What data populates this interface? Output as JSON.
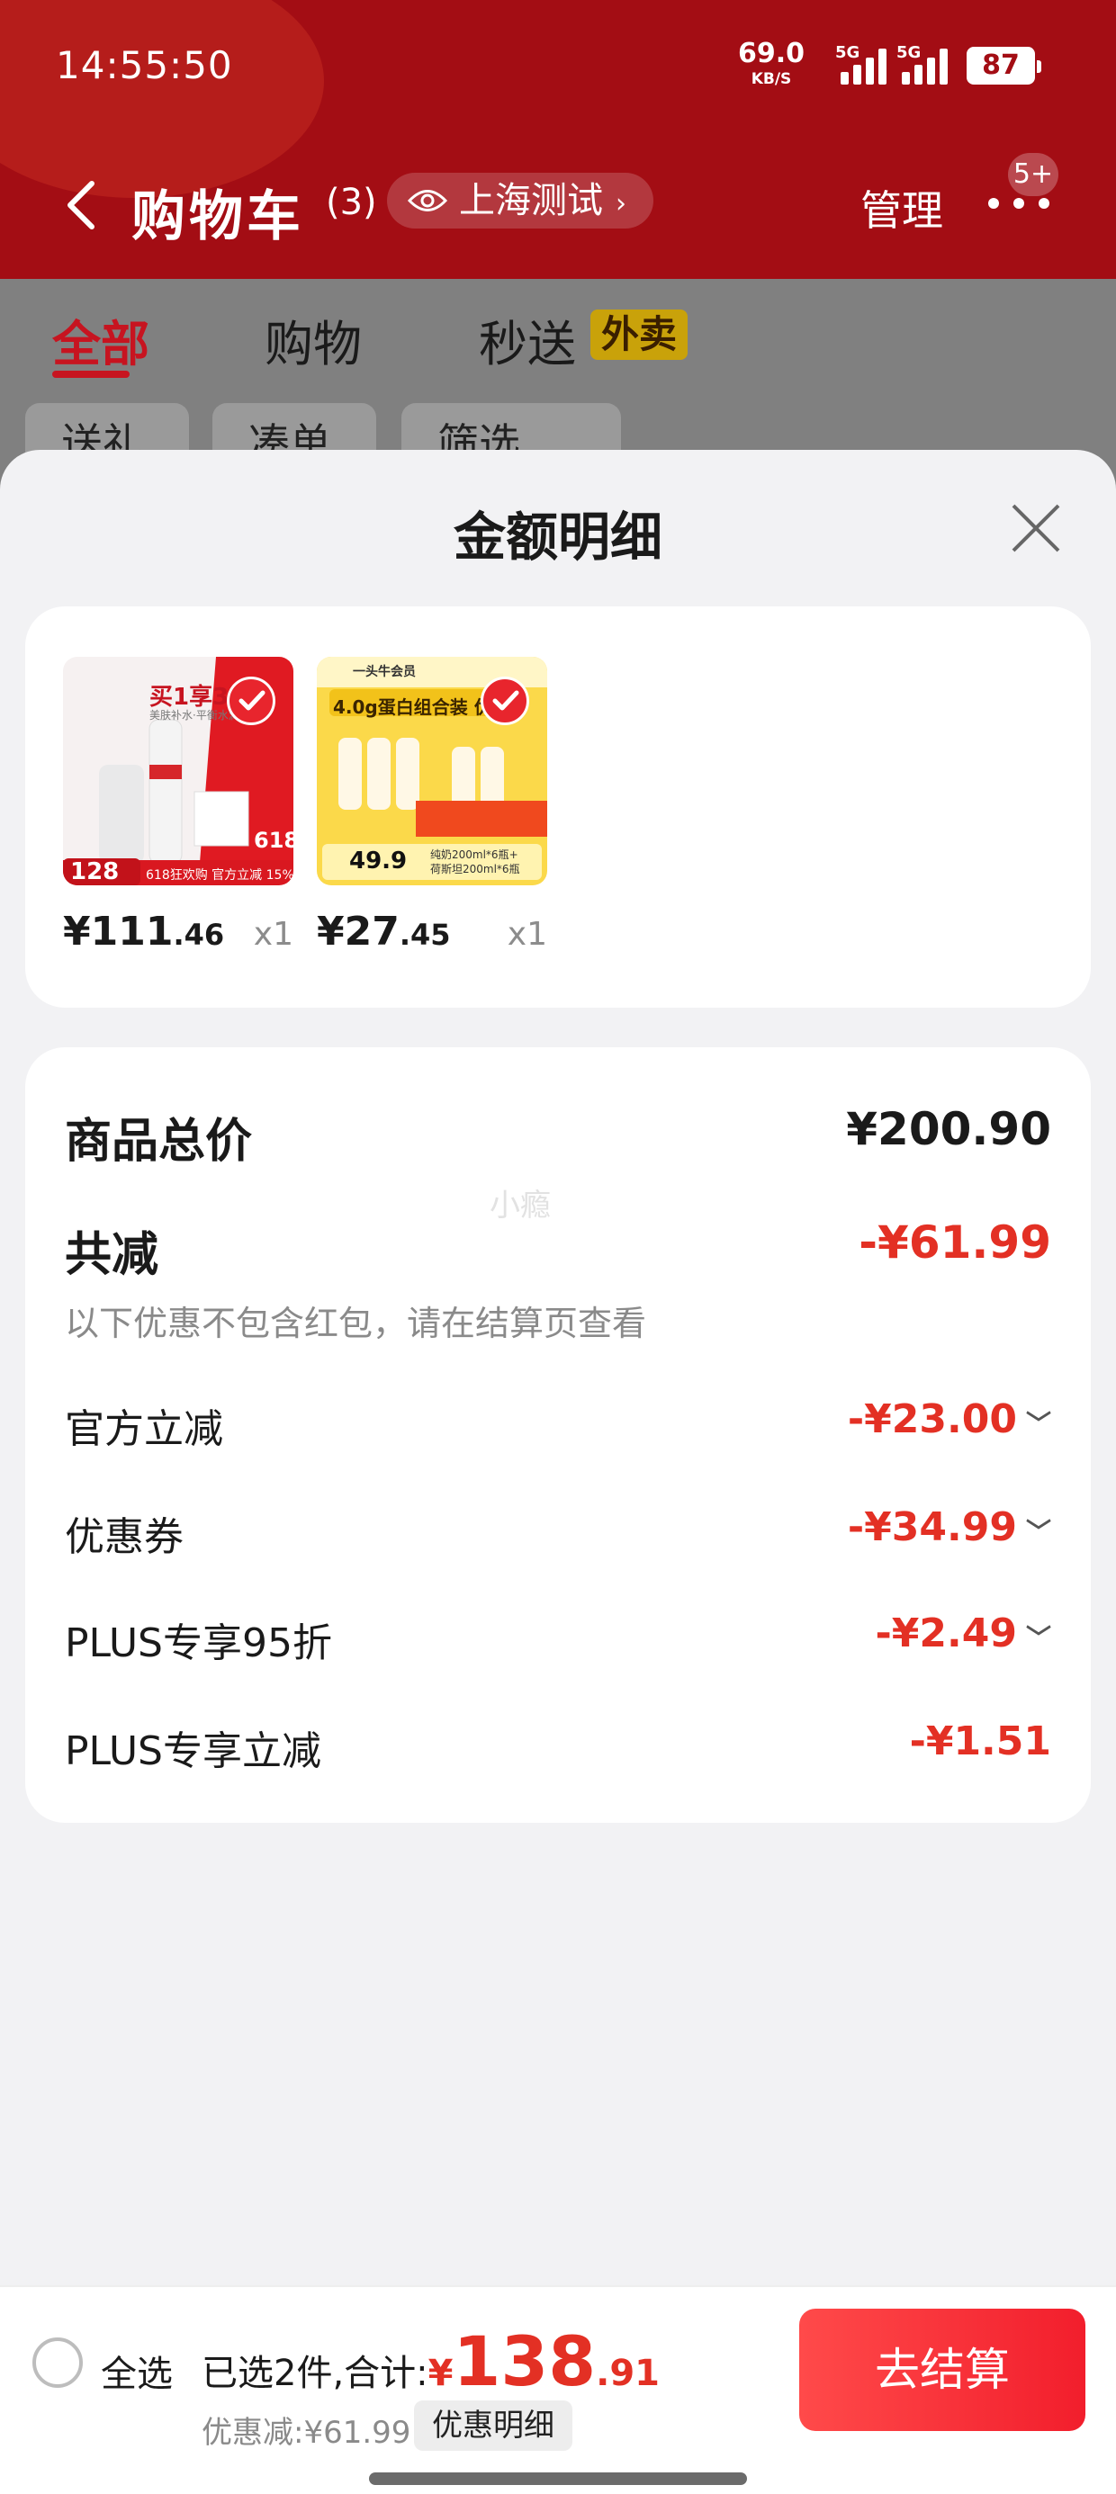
{
  "status_bar": {
    "time": "14:55:50",
    "net_speed": "69.0",
    "net_unit": "KB/S",
    "signal1_label": "5G",
    "signal2_label": "5G",
    "battery": "87"
  },
  "header": {
    "title": "购物车",
    "count": "(3)",
    "location": "上海测试",
    "manage": "管理",
    "badge": "5+"
  },
  "tabs": [
    {
      "label": "全部"
    },
    {
      "label": "购物"
    },
    {
      "label": "秒送"
    }
  ],
  "tab_tag": "外卖",
  "chips": [
    "送礼",
    "凑单",
    "筛选"
  ],
  "sheet": {
    "title": "金额明细",
    "products": [
      {
        "price_int": "¥111",
        "price_dec": ".46",
        "qty": "x1"
      },
      {
        "price_int": "¥27",
        "price_dec": ".45",
        "qty": "x1"
      }
    ],
    "product1_img": {
      "top_text": "买1享3",
      "sub_text": "美肤补水·平衡水润",
      "price": "128",
      "promo": "618狂欢购 官方立减",
      "promo_pct": "15%",
      "big": "618"
    },
    "product2_img": {
      "brand": "一头牛会员",
      "title": "4.0g蛋白组合装 优质",
      "price": "49.9",
      "desc1": "纯奶200ml*6瓶+",
      "desc2": "荷斯坦200ml*6瓶"
    },
    "total_label": "商品总价",
    "total_value": "¥200.90",
    "watermark": "小瘾",
    "reduce_label": "共减",
    "reduce_value": "-¥61.99",
    "note": "以下优惠不包含红包，请在结算页查看",
    "discounts": [
      {
        "label": "官方立减",
        "value": "-¥23.00",
        "expand": true
      },
      {
        "label": "优惠券",
        "value": "-¥34.99",
        "expand": true
      },
      {
        "label": "PLUS专享95折",
        "value": "-¥2.49",
        "expand": true
      },
      {
        "label": "PLUS专享立减",
        "value": "-¥1.51",
        "expand": false
      }
    ]
  },
  "bottom": {
    "select_all": "全选",
    "selected_text": "已选2件,合计:",
    "total_symbol": "¥",
    "total_int": "138",
    "total_dec": ".91",
    "discount_text": "优惠减:¥61.99",
    "detail_button": "优惠明细",
    "checkout": "去结算"
  },
  "colors": {
    "header_red": "#a30d14",
    "accent_red": "#e33024",
    "checkout_red": "#f21e2c"
  }
}
